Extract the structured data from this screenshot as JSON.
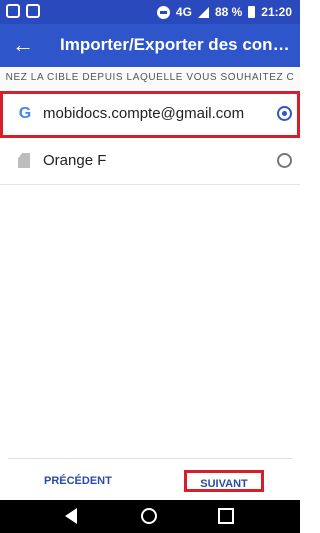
{
  "status_bar": {
    "battery": "88 %",
    "time": "21:20",
    "network": "4G"
  },
  "app_bar": {
    "title": "Importer/Exporter des cont…"
  },
  "instruction": "NEZ LA CIBLE DEPUIS LAQUELLE VOUS SOUHAITEZ C",
  "accounts": [
    {
      "label": "mobidocs.compte@gmail.com",
      "icon": "google-icon",
      "selected": true
    },
    {
      "label": "Orange F",
      "icon": "sim-card-icon",
      "selected": false
    }
  ],
  "buttons": {
    "previous": "PRÉCÉDENT",
    "next": "SUIVANT"
  },
  "colors": {
    "primary": "#2e55c9",
    "highlight": "#d71f2b"
  }
}
